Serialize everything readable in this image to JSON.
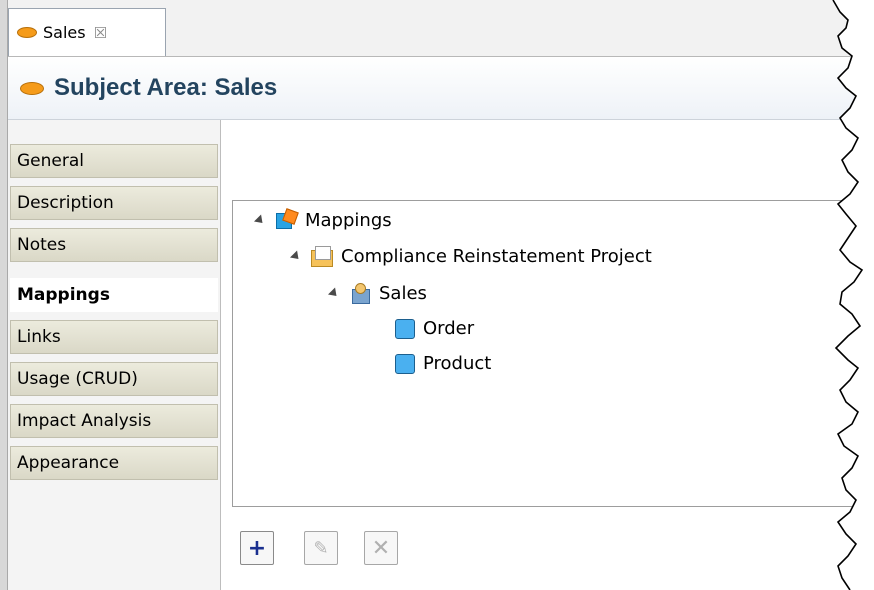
{
  "tab": {
    "label": "Sales",
    "close_glyph": "☒",
    "icon": "oval-icon"
  },
  "header": {
    "title": "Subject Area: Sales",
    "icon": "oval-icon"
  },
  "sidebar": {
    "items": [
      {
        "label": "General"
      },
      {
        "label": "Description"
      },
      {
        "label": "Notes"
      },
      {
        "label": "Mappings",
        "active": true
      },
      {
        "label": "Links"
      },
      {
        "label": "Usage (CRUD)"
      },
      {
        "label": "Impact Analysis"
      },
      {
        "label": "Appearance"
      }
    ]
  },
  "tree": {
    "nodes": [
      {
        "label": "Mappings",
        "icon": "mappings-icon"
      },
      {
        "label": "Compliance Reinstatement Project",
        "icon": "project-folder-icon"
      },
      {
        "label": "Sales",
        "icon": "subject-area-icon"
      },
      {
        "label": "Order",
        "icon": "entity-icon"
      },
      {
        "label": "Product",
        "icon": "entity-icon"
      }
    ]
  },
  "toolbar": {
    "add_glyph": "+",
    "edit_glyph": "✎",
    "delete_glyph": "✕"
  },
  "colors": {
    "oval": "#f59b1a",
    "header_title": "#23445f",
    "add_icon": "#1a2f8f"
  }
}
